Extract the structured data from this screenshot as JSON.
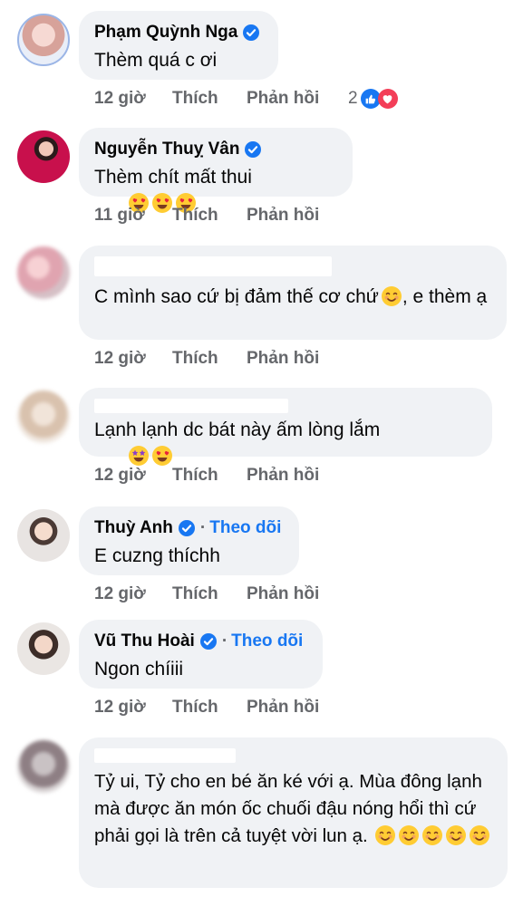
{
  "comments": [
    {
      "author": "Phạm Quỳnh Nga",
      "verified": true,
      "follow": "",
      "text": "Thèm quá c ơi",
      "time": "12 giờ",
      "like": "Thích",
      "reply": "Phản hồi",
      "reaction_count": "2"
    },
    {
      "author": "Nguyễn Thuỵ Vân",
      "verified": true,
      "follow": "",
      "text": "Thèm chít mất thui",
      "emoji": [
        "heart-eyes",
        "heart-eyes",
        "heart-eyes"
      ],
      "time": "11 giờ",
      "like": "Thích",
      "reply": "Phản hồi"
    },
    {
      "author": "",
      "text": "C mình sao cứ bị đảm thế cơ chứ",
      "text_after_emoji": ", e thèm ạ",
      "time": "12 giờ",
      "like": "Thích",
      "reply": "Phản hồi"
    },
    {
      "author": "",
      "text": "Lạnh lạnh dc bát này ấm lòng lắm",
      "time": "12 giờ",
      "like": "Thích",
      "reply": "Phản hồi"
    },
    {
      "author": "Thuỳ Anh",
      "verified": true,
      "follow": "Theo dõi",
      "text": "E cuzng thíchh",
      "time": "12 giờ",
      "like": "Thích",
      "reply": "Phản hồi"
    },
    {
      "author": "Vũ Thu Hoài",
      "verified": true,
      "follow": "Theo dõi",
      "text": "Ngon chíiii",
      "time": "12 giờ",
      "like": "Thích",
      "reply": "Phản hồi"
    },
    {
      "author": "",
      "text": "Tỷ ui, Tỷ cho en bé ăn ké với ạ. Mùa đông lạnh mà được ăn món ốc chuối đậu nóng hổi thì cứ phải gọi là trên cả tuyệt vời lun ạ."
    }
  ],
  "colors": {
    "bubble": "#f0f2f5",
    "link": "#1877f2",
    "meta": "#65676b",
    "like_reaction": "#1877f2",
    "love_reaction": "#f33e58"
  }
}
